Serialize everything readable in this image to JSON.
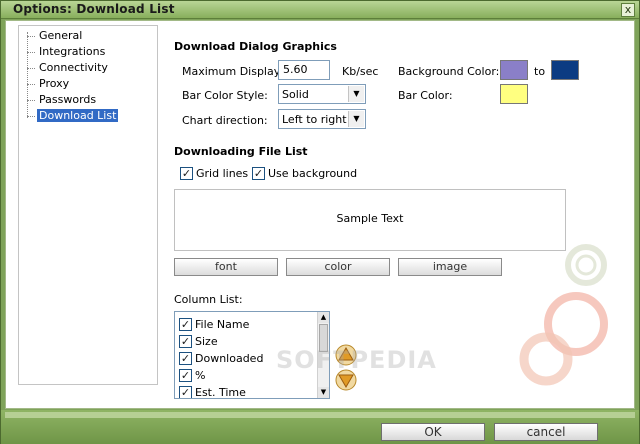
{
  "window": {
    "title": "Options: Download List",
    "close_label": "x"
  },
  "tree": {
    "items": [
      {
        "label": "General"
      },
      {
        "label": "Integrations"
      },
      {
        "label": "Connectivity"
      },
      {
        "label": "Proxy"
      },
      {
        "label": "Passwords"
      },
      {
        "label": "Download List",
        "selected": true
      }
    ]
  },
  "graphics": {
    "section_title": "Download Dialog Graphics",
    "max_display_label": "Maximum Display:",
    "max_display_value": "5.60",
    "max_display_unit": "Kb/sec",
    "bar_style_label": "Bar Color Style:",
    "bar_style_value": "Solid",
    "chart_direction_label": "Chart direction:",
    "chart_direction_value": "Left to right",
    "bg_color_label": "Background Color:",
    "bg_color_from": "#8a7fc8",
    "bg_color_to_label": "to",
    "bg_color_to": "#0b3b82",
    "bar_color_label": "Bar Color:",
    "bar_color": "#ffff80"
  },
  "file_list": {
    "section_title": "Downloading File List",
    "grid_lines_label": "Grid lines",
    "grid_lines_checked": true,
    "use_bg_label": "Use background",
    "use_bg_checked": true,
    "sample_text": "Sample Text",
    "font_button": "font",
    "color_button": "color",
    "image_button": "image"
  },
  "columns": {
    "label": "Column List:",
    "items": [
      {
        "label": "File Name",
        "checked": true
      },
      {
        "label": "Size",
        "checked": true
      },
      {
        "label": "Downloaded",
        "checked": true
      },
      {
        "label": "%",
        "checked": true
      },
      {
        "label": "Est. Time",
        "checked": true
      }
    ],
    "move_up_icon": "arrow-up-icon",
    "move_down_icon": "arrow-down-icon"
  },
  "footer": {
    "ok_label": "OK",
    "cancel_label": "cancel"
  },
  "watermark": "SOFTPEDIA"
}
